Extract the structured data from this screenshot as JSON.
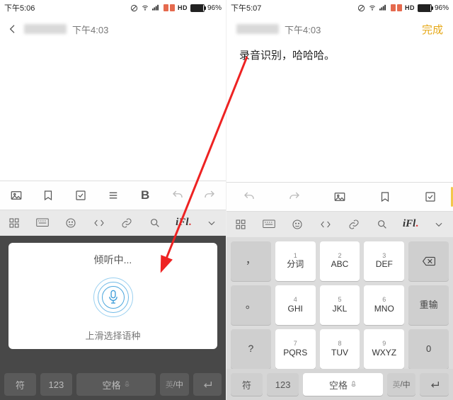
{
  "left": {
    "status_time": "下午5:06",
    "battery_pct": "96%",
    "hd": "HD",
    "header_time": "下午4:03",
    "voice": {
      "listening": "倾听中...",
      "swipe_hint": "上滑选择语种"
    },
    "bottom": {
      "sym": "符",
      "num": "123",
      "space": "空格",
      "lang_en": "英",
      "lang_cn": "中"
    }
  },
  "right": {
    "status_time": "下午5:07",
    "battery_pct": "96%",
    "hd": "HD",
    "header_time": "下午4:03",
    "done": "完成",
    "note_text": "录音识别，哈哈哈。",
    "keys": {
      "fenci": "分词",
      "abc": "ABC",
      "def": "DEF",
      "ghi": "GHI",
      "jkl": "JKL",
      "mno": "MNO",
      "pqrs": "PQRS",
      "tuv": "TUV",
      "wxyz": "WXYZ",
      "chongshu": "重输",
      "h1": "1",
      "h2": "2",
      "h3": "3",
      "h4": "4",
      "h5": "5",
      "h6": "6",
      "h7": "7",
      "h8": "8",
      "h9": "9"
    },
    "bottom": {
      "sym": "符",
      "num": "123",
      "space": "空格",
      "lang_en": "英",
      "lang_cn": "中"
    }
  },
  "ime_brand": "iFl"
}
